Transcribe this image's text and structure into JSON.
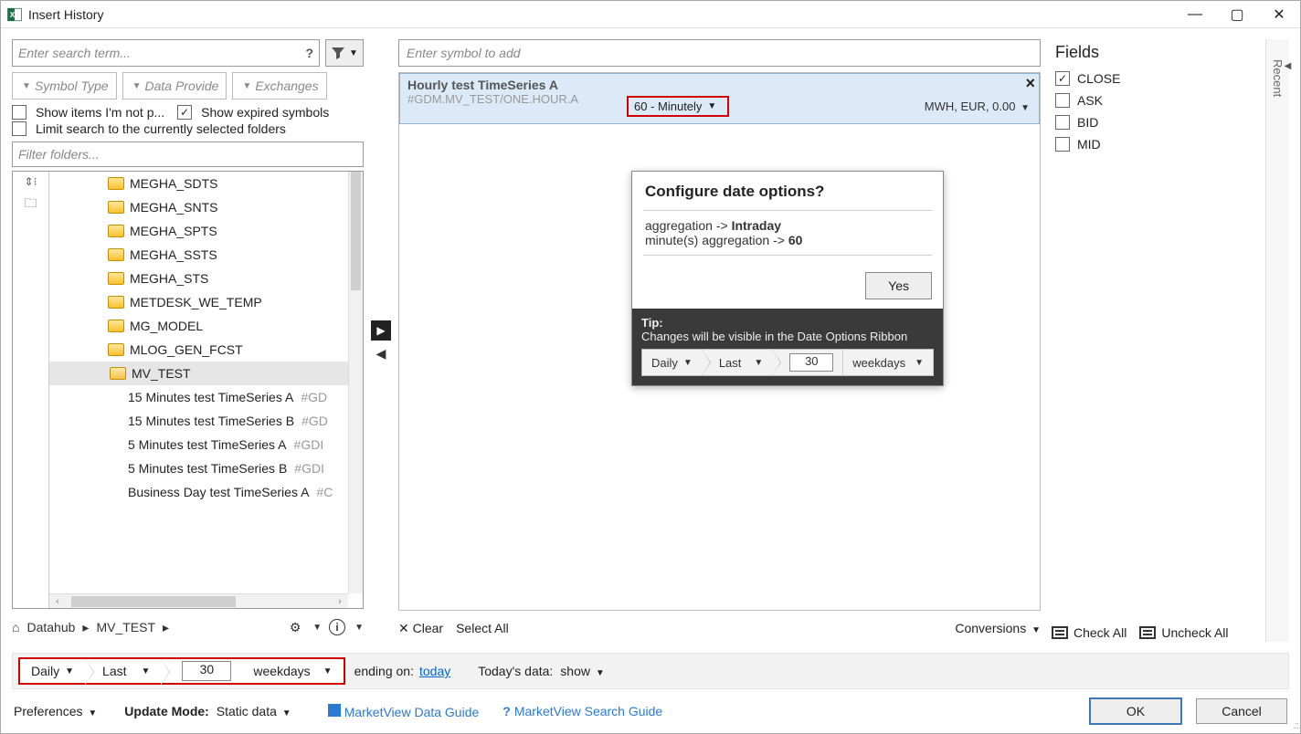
{
  "window": {
    "title": "Insert History"
  },
  "search": {
    "placeholder": "Enter search term...",
    "help": "?"
  },
  "filters": {
    "symbolType": "Symbol Type",
    "dataProvider": "Data Provide",
    "exchanges": "Exchanges",
    "showNotPermissioned": "Show items I'm not p...",
    "showExpired": "Show expired symbols",
    "limitFolders": "Limit search to the currently selected folders",
    "filterFolders": "Filter folders..."
  },
  "folders": [
    "MEGHA_SDTS",
    "MEGHA_SNTS",
    "MEGHA_SPTS",
    "MEGHA_SSTS",
    "MEGHA_STS",
    "METDESK_WE_TEMP",
    "MG_MODEL",
    "MLOG_GEN_FCST",
    "MV_TEST"
  ],
  "children": [
    {
      "n": "15 Minutes test TimeSeries A",
      "c": "#GD"
    },
    {
      "n": "15 Minutes test TimeSeries B",
      "c": "#GD"
    },
    {
      "n": "5 Minutes test TimeSeries A",
      "c": "#GDI"
    },
    {
      "n": "5 Minutes test TimeSeries B",
      "c": "#GDI"
    },
    {
      "n": "Business Day test TimeSeries A",
      "c": "#C"
    }
  ],
  "breadcrumb": {
    "root": "Datahub",
    "sel": "MV_TEST"
  },
  "main": {
    "symbolPlaceholder": "Enter symbol to add",
    "series": {
      "name": "Hourly test TimeSeries A",
      "code": "#GDM.MV_TEST/ONE.HOUR.A",
      "granularity": "60 - Minutely",
      "meta": "MWH, EUR, 0.00"
    },
    "footer": {
      "clear": "Clear",
      "selectAll": "Select All",
      "conversions": "Conversions"
    }
  },
  "popup": {
    "title": "Configure date options?",
    "l1a": "aggregation  ->  ",
    "l1b": "Intraday",
    "l2a": "minute(s) aggregation  ->  ",
    "l2b": "60",
    "yes": "Yes",
    "tipLabel": "Tip:",
    "tipText": "Changes will be visible in the Date Options Ribbon",
    "ribbon": {
      "daily": "Daily",
      "last": "Last",
      "count": "30",
      "unit": "weekdays"
    }
  },
  "fields": {
    "title": "Fields",
    "items": [
      {
        "label": "CLOSE",
        "checked": true
      },
      {
        "label": "ASK",
        "checked": false
      },
      {
        "label": "BID",
        "checked": false
      },
      {
        "label": "MID",
        "checked": false
      }
    ],
    "checkAll": "Check All",
    "uncheckAll": "Uncheck All"
  },
  "sidetab": "Recent",
  "dateRow": {
    "daily": "Daily",
    "last": "Last",
    "count": "30",
    "unit": "weekdays",
    "endingOn": "ending on:",
    "endVal": "today",
    "todaysData": "Today's data:",
    "show": "show"
  },
  "bottom": {
    "prefs": "Preferences",
    "updateMode": "Update Mode:",
    "updateVal": "Static data",
    "guide1": "MarketView Data Guide",
    "guide2": "MarketView Search Guide",
    "ok": "OK",
    "cancel": "Cancel"
  }
}
